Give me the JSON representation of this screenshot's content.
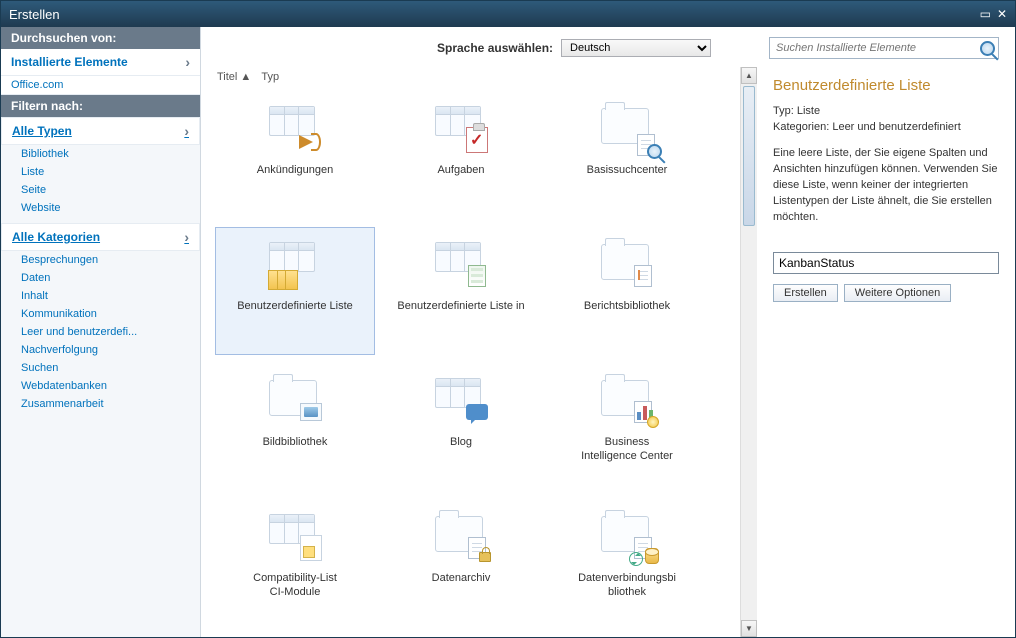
{
  "titlebar": {
    "title": "Erstellen"
  },
  "sidebar": {
    "browse_header": "Durchsuchen von:",
    "browse_links": [
      {
        "label": "Installierte Elemente",
        "primary": true
      },
      {
        "label": "Office.com",
        "primary": false
      }
    ],
    "filter_header": "Filtern nach:",
    "types_header": "Alle Typen",
    "types": [
      "Bibliothek",
      "Liste",
      "Seite",
      "Website"
    ],
    "categories_header": "Alle Kategorien",
    "categories": [
      "Besprechungen",
      "Daten",
      "Inhalt",
      "Kommunikation",
      "Leer und benutzerdefi...",
      "Nachverfolgung",
      "Suchen",
      "Webdatenbanken",
      "Zusammenarbeit"
    ]
  },
  "topbar": {
    "lang_label": "Sprache auswählen:",
    "lang_value": "Deutsch",
    "search_placeholder": "Suchen Installierte Elemente"
  },
  "sort": {
    "title": "Titel",
    "type": "Typ"
  },
  "tiles": [
    {
      "label": "Ankündigungen",
      "icon": "announce"
    },
    {
      "label": "Aufgaben",
      "icon": "tasks"
    },
    {
      "label": "Basissuchcenter",
      "icon": "searchcenter"
    },
    {
      "label": "Benutzerdefinierte Liste",
      "icon": "customlist",
      "selected": true
    },
    {
      "label": "Benutzerdefinierte Liste in",
      "icon": "customlist2"
    },
    {
      "label": "Berichtsbibliothek",
      "icon": "reportlib"
    },
    {
      "label": "Bildbibliothek",
      "icon": "piclib"
    },
    {
      "label": [
        "Business",
        "Intelligence Center"
      ],
      "icon": "bi"
    },
    {
      "label": "Blog",
      "icon": "blog"
    },
    {
      "label": [
        "Compatibility-List",
        "CI-Module"
      ],
      "icon": "compat"
    },
    {
      "label": "Datenarchiv",
      "icon": "archive"
    },
    {
      "label": [
        "Datenverbindungsbi",
        "bliothek"
      ],
      "icon": "dataconn"
    }
  ],
  "tiles_display_order": [
    0,
    1,
    2,
    3,
    4,
    5,
    6,
    8,
    7,
    9,
    10,
    11
  ],
  "details": {
    "title": "Benutzerdefinierte Liste",
    "type_label": "Typ:",
    "type_value": "Liste",
    "cat_label": "Kategorien:",
    "cat_value": "Leer und benutzerdefiniert",
    "description": "Eine leere Liste, der Sie eigene Spalten und Ansichten hinzufügen können. Verwenden Sie diese Liste, wenn keiner der integrierten Listentypen der Liste ähnelt, die Sie erstellen möchten.",
    "name_value": "KanbanStatus",
    "create_btn": "Erstellen",
    "more_btn": "Weitere Optionen"
  }
}
